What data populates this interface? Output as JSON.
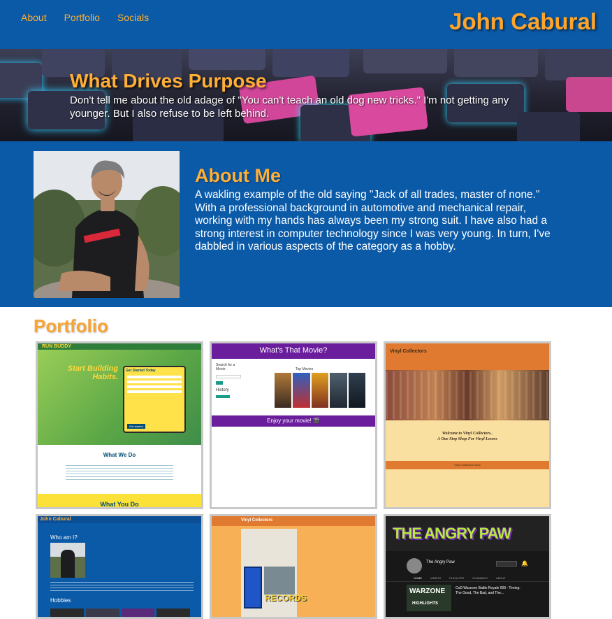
{
  "header": {
    "nav": [
      "About",
      "Portfolio",
      "Socials"
    ],
    "brand": "John Cabural"
  },
  "hero": {
    "title": "What Drives Purpose",
    "text": "Don't tell me about the old adage of \"You can't teach an old dog new tricks.\" I'm not getting any younger. But I also refuse to be left behind."
  },
  "about": {
    "title": "About Me",
    "text": "A wakling example of the old saying \"Jack of all trades, master of none.\" With a professional background in automotive and mechanical repair, working with my hands has always been my strong suit. I have also had a strong interest in computer technology since I was very young. In turn, I've dabbled in various aspects of the category as a hobby."
  },
  "portfolio": {
    "title": "Portfolio",
    "cards": [
      {
        "name": "Run Buddy",
        "logo": "RUN BUDDY",
        "heading": "Start Building Habits.",
        "form_title": "Get Started Today",
        "section1": "What We Do",
        "section2": "What You Do",
        "form_button": "Get started"
      },
      {
        "name": "What's That Movie?",
        "title": "What's That Movie?",
        "search_label": "Search for a Movie:",
        "top_movies": "Top Movies",
        "history": "History",
        "footer": "Enjoy your movie! 🎬"
      },
      {
        "name": "Vinyl Collectors",
        "title": "Vinyl Collectors",
        "welcome": "Welcome to Vinyl Collectors..",
        "tagline": "A One Stop Shop For Vinyl Lovers",
        "footer": "Vinyl Collectors 2022"
      },
      {
        "name": "John Cabural",
        "brand": "John Cabural",
        "who": "Who am I?",
        "hobbies": "Hobbies"
      },
      {
        "name": "Vinyl Collectors",
        "title": "Vinyl Collectors",
        "sign": "RECORDS"
      },
      {
        "name": "The Angry Paw",
        "banner": "THE ANGRY PAW",
        "channel": "The Angry Paw",
        "tabs": [
          "HOME",
          "VIDEOS",
          "PLAYLISTS",
          "CHANNELS",
          "ABOUT"
        ],
        "video_title": "CoD:Warzone Battle Royale 009 - Timing: The Good, The Bad, and The...",
        "game": "WARZONE",
        "highlights": "HIGHLIGHTS"
      }
    ]
  },
  "colors": {
    "header_bg": "#0b5aa8",
    "accent": "#ffae36",
    "card_border": "#c8c8c8"
  }
}
